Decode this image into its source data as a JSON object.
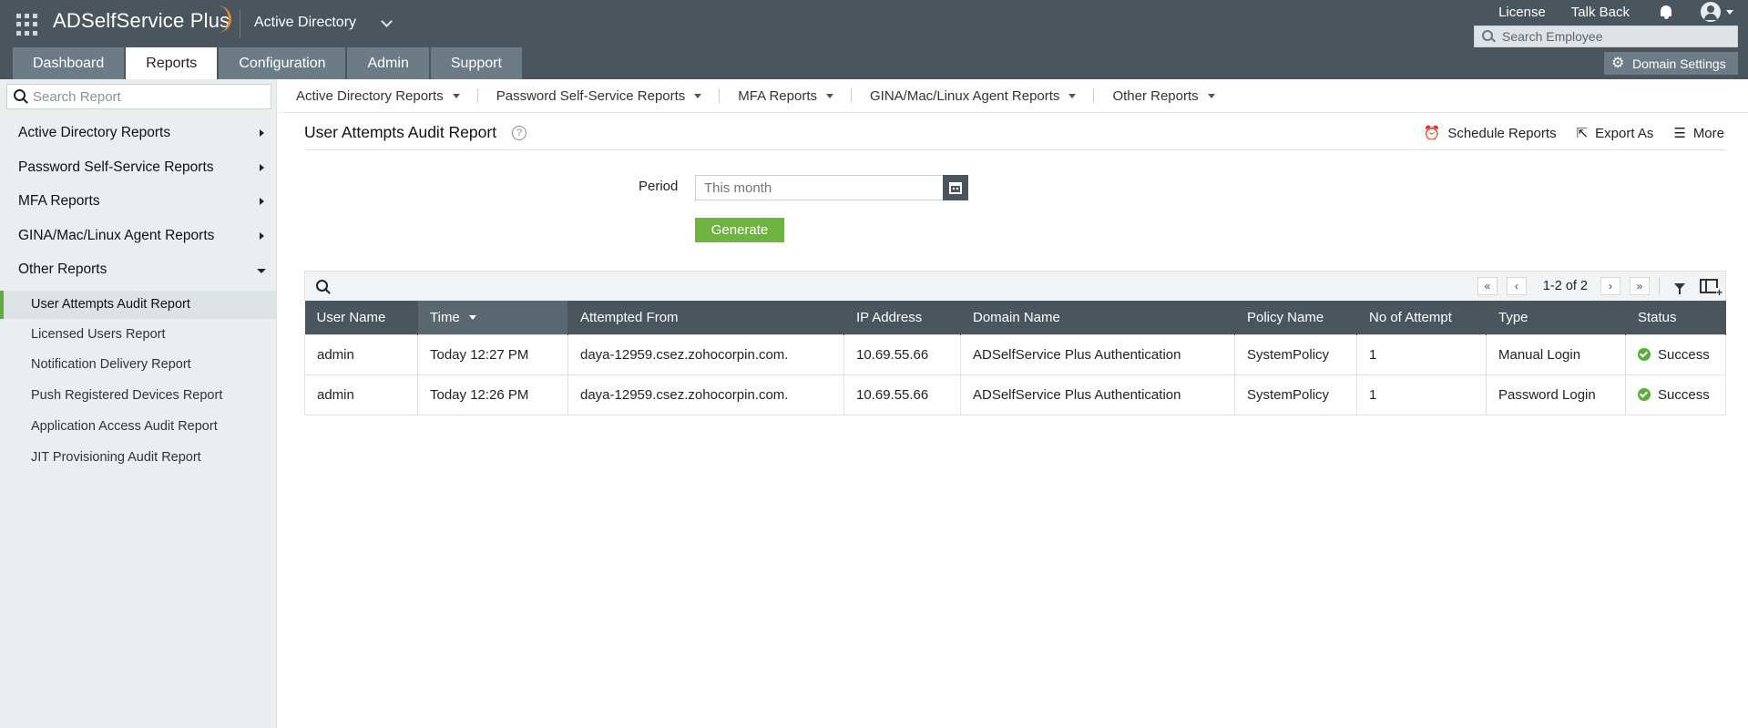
{
  "header": {
    "brand": "ADSelfService Plus",
    "domain_selector": "Active Directory",
    "links": {
      "license": "License",
      "talk_back": "Talk Back"
    },
    "search_placeholder": "Search Employee",
    "domain_settings": "Domain Settings",
    "tabs": [
      {
        "label": "Dashboard",
        "active": false
      },
      {
        "label": "Reports",
        "active": true
      },
      {
        "label": "Configuration",
        "active": false
      },
      {
        "label": "Admin",
        "active": false
      },
      {
        "label": "Support",
        "active": false
      }
    ]
  },
  "sidebar": {
    "search_placeholder": "Search Report",
    "categories": [
      {
        "label": "Active Directory Reports",
        "expanded": false
      },
      {
        "label": "Password Self-Service Reports",
        "expanded": false
      },
      {
        "label": "MFA Reports",
        "expanded": false
      },
      {
        "label": "GINA/Mac/Linux Agent Reports",
        "expanded": false
      },
      {
        "label": "Other Reports",
        "expanded": true
      }
    ],
    "subitems": [
      {
        "label": "User Attempts Audit Report",
        "active": true
      },
      {
        "label": "Licensed Users Report",
        "active": false
      },
      {
        "label": "Notification Delivery Report",
        "active": false
      },
      {
        "label": "Push Registered Devices Report",
        "active": false
      },
      {
        "label": "Application Access Audit Report",
        "active": false
      },
      {
        "label": "JIT Provisioning Audit Report",
        "active": false
      }
    ]
  },
  "report_tabs": [
    "Active Directory Reports",
    "Password Self-Service Reports",
    "MFA Reports",
    "GINA/Mac/Linux Agent Reports",
    "Other Reports"
  ],
  "main": {
    "title": "User Attempts Audit Report",
    "help": "?",
    "actions": {
      "schedule": "Schedule Reports",
      "export": "Export As",
      "more": "More"
    },
    "period_label": "Period",
    "period_placeholder": "This month",
    "generate_label": "Generate",
    "pager_text": "1-2 of 2",
    "table": {
      "columns": [
        "User Name",
        "Time",
        "Attempted From",
        "IP Address",
        "Domain Name",
        "Policy Name",
        "No of Attempt",
        "Type",
        "Status"
      ],
      "rows": [
        [
          "admin",
          "Today 12:27 PM",
          "daya-12959.csez.zohocorpin.com.",
          "10.69.55.66",
          "ADSelfService Plus Authentication",
          "SystemPolicy",
          "1",
          "Manual Login",
          "Success"
        ],
        [
          "admin",
          "Today 12:26 PM",
          "daya-12959.csez.zohocorpin.com.",
          "10.69.55.66",
          "ADSelfService Plus Authentication",
          "SystemPolicy",
          "1",
          "Password Login",
          "Success"
        ]
      ]
    }
  },
  "colors": {
    "header_bg": "#4a555e",
    "tab_bg": "#6c7c87",
    "accent_green": "#6fb440",
    "sidebar_bg": "#ebeeef",
    "logo_swoosh": "#e98b2a"
  }
}
